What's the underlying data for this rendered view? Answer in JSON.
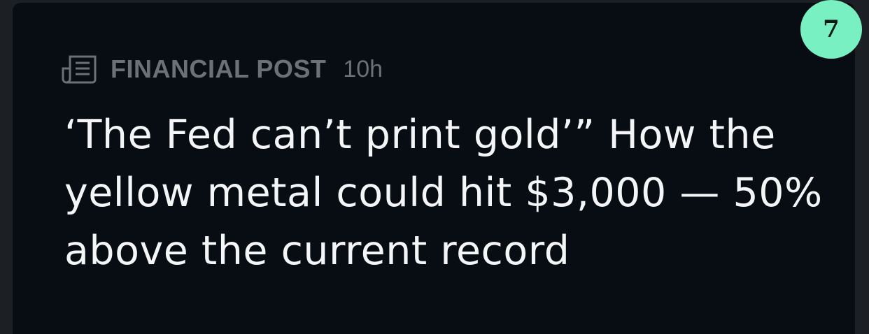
{
  "unread_count": "7",
  "article": {
    "source_icon": "newspaper-icon",
    "source": "FINANCIAL POST",
    "time_ago": "10h",
    "headline": "‘The Fed can’t print gold’” How the yellow metal could hit $3,000 — 50% above the current record"
  },
  "colors": {
    "card_background": "#080d14",
    "badge_background": "#79f0c2",
    "meta_text": "#6c7079",
    "headline_text": "#f4f5f7"
  }
}
